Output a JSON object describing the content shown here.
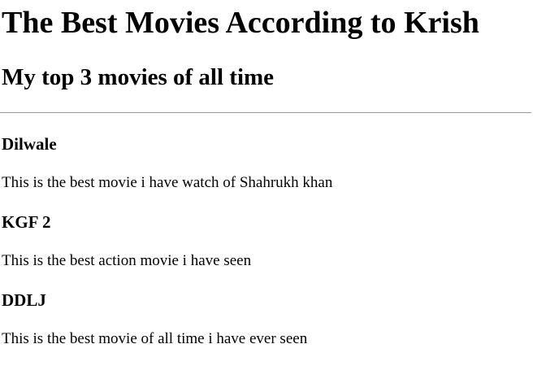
{
  "page": {
    "title": "The Best Movies According to Krish",
    "subtitle": "My top 3 movies of all time"
  },
  "movies": [
    {
      "title": "Dilwale",
      "description": "This is the best movie i have watch of Shahrukh khan"
    },
    {
      "title": "KGF 2",
      "description": "This is the best action movie i have seen"
    },
    {
      "title": "DDLJ",
      "description": "This is the best movie of all time i have ever seen"
    }
  ]
}
